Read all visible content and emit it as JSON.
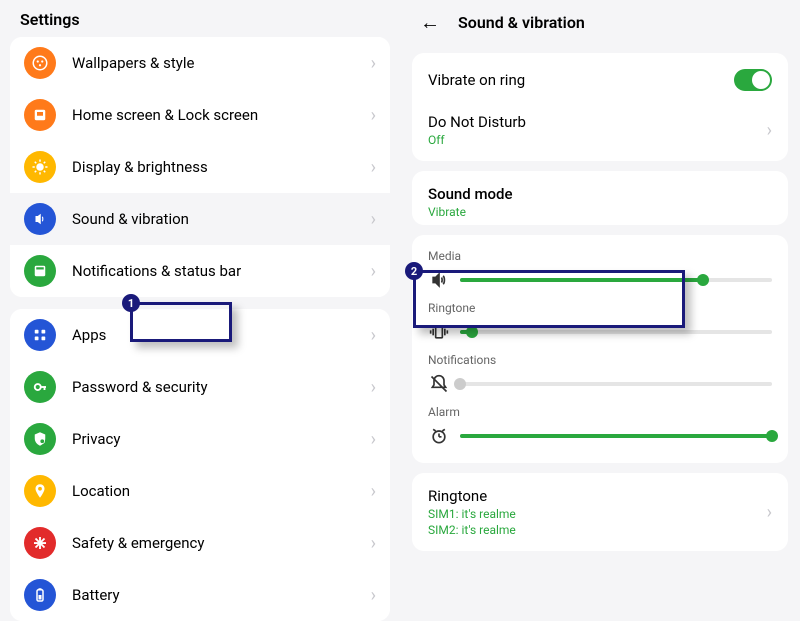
{
  "left": {
    "header": "Settings",
    "group1": [
      {
        "icon": "wallpaper-icon",
        "label": "Wallpapers & style"
      },
      {
        "icon": "home-icon",
        "label": "Home screen & Lock screen"
      },
      {
        "icon": "display-icon",
        "label": "Display & brightness"
      },
      {
        "icon": "sound-icon",
        "label": "Sound & vibration"
      },
      {
        "icon": "notification-icon",
        "label": "Notifications & status bar"
      }
    ],
    "group2": [
      {
        "icon": "apps-icon",
        "label": "Apps"
      },
      {
        "icon": "password-icon",
        "label": "Password & security"
      },
      {
        "icon": "privacy-icon",
        "label": "Privacy"
      },
      {
        "icon": "location-icon",
        "label": "Location"
      },
      {
        "icon": "safety-icon",
        "label": "Safety & emergency"
      },
      {
        "icon": "battery-icon",
        "label": "Battery"
      }
    ]
  },
  "right": {
    "title": "Sound & vibration",
    "vibrate_on_ring": "Vibrate on ring",
    "dnd": {
      "title": "Do Not Disturb",
      "sub": "Off"
    },
    "sound_mode": {
      "title": "Sound mode",
      "sub": "Vibrate"
    },
    "volumes": {
      "media": {
        "label": "Media",
        "value": 78
      },
      "ringtone": {
        "label": "Ringtone",
        "value": 4
      },
      "notifications": {
        "label": "Notifications",
        "value": 0
      },
      "alarm": {
        "label": "Alarm",
        "value": 100
      }
    },
    "ringtone": {
      "title": "Ringtone",
      "sub1": "SIM1: it's realme",
      "sub2": "SIM2: it's realme"
    }
  },
  "annotations": {
    "a1": "1",
    "a2": "2"
  }
}
